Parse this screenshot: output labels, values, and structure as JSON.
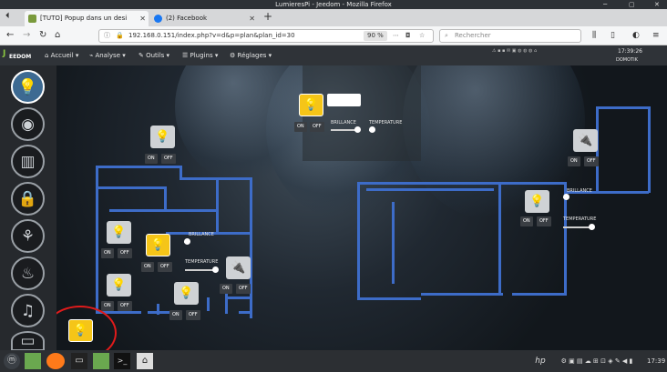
{
  "window_title": "LumieresPi - Jeedom - Mozilla Firefox",
  "tabs": [
    {
      "label": "[TUTO] Popup dans un desi",
      "active": true
    },
    {
      "label": "(2) Facebook",
      "active": false
    }
  ],
  "url": "192.168.0.151/index.php?v=d&p=plan&plan_id=30",
  "zoom": "90 %",
  "search_placeholder": "Rechercher",
  "app": {
    "logo": "EEDOM",
    "menu": [
      "Accueil",
      "Analyse",
      "Outils",
      "Plugins",
      "Réglages"
    ],
    "time": "17:39:26",
    "user": "DOMOTIK"
  },
  "plan": {
    "labels": {
      "on": "ON",
      "off": "OFF",
      "brillance": "BRILLANCE",
      "temperature": "TEMPERATURE"
    }
  },
  "taskbar": {
    "clock": "17:39"
  }
}
